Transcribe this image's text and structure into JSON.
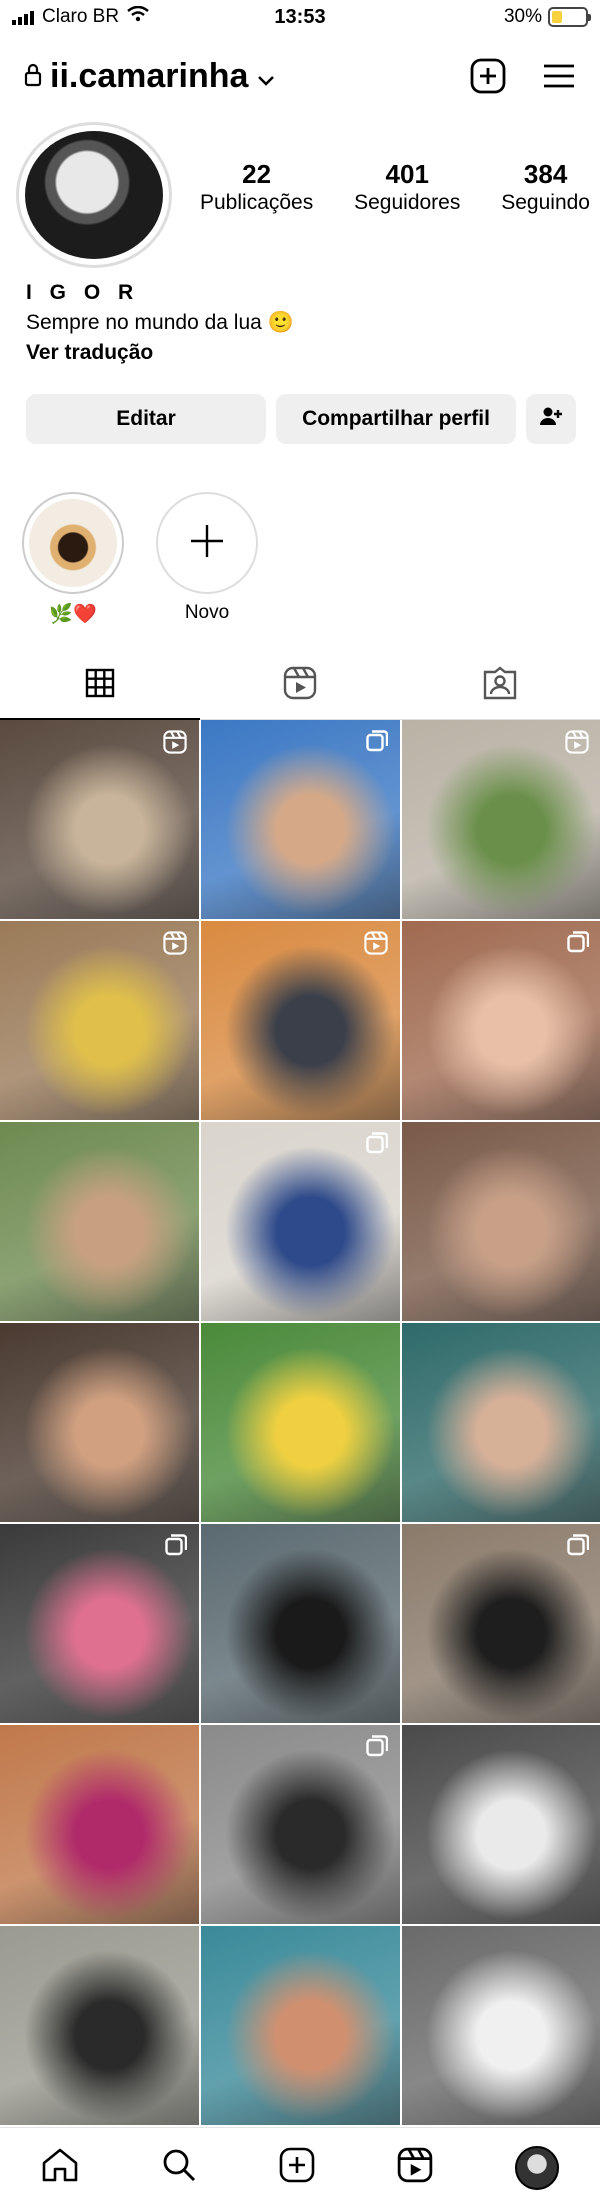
{
  "status_bar": {
    "carrier": "Claro BR",
    "time": "13:53",
    "battery": "30%",
    "battery_level": 0.3
  },
  "header": {
    "username": "ii.camarinha"
  },
  "profile": {
    "stats": [
      {
        "value": "22",
        "label": "Publicações"
      },
      {
        "value": "401",
        "label": "Seguidores"
      },
      {
        "value": "384",
        "label": "Seguindo"
      }
    ],
    "name": "I G O R",
    "bio": "Sempre no mundo da lua 🙂",
    "translate": "Ver tradução"
  },
  "buttons": {
    "edit": "Editar",
    "share": "Compartilhar perfil"
  },
  "highlights": [
    {
      "label": "🌿❤️"
    },
    {
      "label": "Novo"
    }
  ],
  "grid": {
    "tiles": [
      {
        "bg": "#5a4a3f",
        "accent": "#c8b49a",
        "type": "reels"
      },
      {
        "bg": "#3b78c4",
        "accent": "#d5a988",
        "type": "carousel"
      },
      {
        "bg": "#b9b2a5",
        "accent": "#6a8f4a",
        "type": "reels"
      },
      {
        "bg": "#9a7a58",
        "accent": "#e0c04a",
        "type": "reels"
      },
      {
        "bg": "#d98a40",
        "accent": "#3a3f4a",
        "type": "reels"
      },
      {
        "bg": "#a06a50",
        "accent": "#e8c0a8",
        "type": "carousel"
      },
      {
        "bg": "#6e8a50",
        "accent": "#c7a080",
        "type": "none"
      },
      {
        "bg": "#d9d4cc",
        "accent": "#2e4a8a",
        "type": "carousel"
      },
      {
        "bg": "#7a5a48",
        "accent": "#c8a088",
        "type": "none"
      },
      {
        "bg": "#4a3a30",
        "accent": "#d0a080",
        "type": "none"
      },
      {
        "bg": "#4a8a3a",
        "accent": "#f0d040",
        "type": "none"
      },
      {
        "bg": "#2f6a6a",
        "accent": "#d7b098",
        "type": "none"
      },
      {
        "bg": "#3a3a3a",
        "accent": "#e07090",
        "type": "carousel"
      },
      {
        "bg": "#5a6a70",
        "accent": "#1a1a1a",
        "type": "none"
      },
      {
        "bg": "#8a7a6a",
        "accent": "#1e1e1e",
        "type": "carousel"
      },
      {
        "bg": "#c0784a",
        "accent": "#b02a6a",
        "type": "none"
      },
      {
        "bg": "#8a8a8a",
        "accent": "#2a2a2a",
        "type": "carousel"
      },
      {
        "bg": "#4a4a4a",
        "accent": "#eaeaea",
        "type": "none"
      },
      {
        "bg": "#9a9a90",
        "accent": "#2a2a2a",
        "type": "none"
      },
      {
        "bg": "#3a8a9a",
        "accent": "#d09070",
        "type": "none"
      },
      {
        "bg": "#6a6a6a",
        "accent": "#f0f0f0",
        "type": "none"
      }
    ]
  }
}
